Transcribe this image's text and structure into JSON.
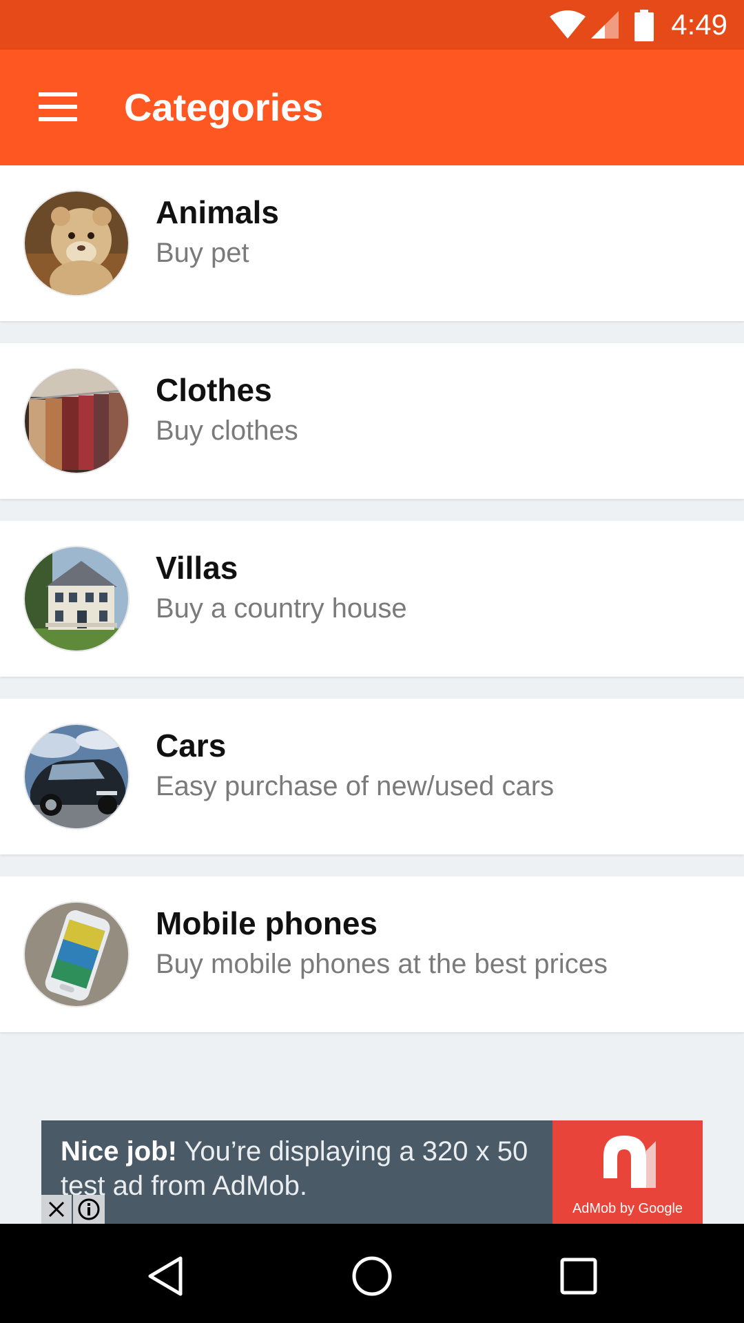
{
  "status_bar": {
    "time": "4:49",
    "icons": [
      "wifi-icon",
      "signal-icon",
      "battery-icon"
    ]
  },
  "app_bar": {
    "title": "Categories",
    "menu_icon": "menu-icon",
    "background": "#ff5722",
    "status_background": "#e64a19"
  },
  "categories": [
    {
      "name": "Animals",
      "subtitle": "Buy pet",
      "image": "lion-cub-photo"
    },
    {
      "name": "Clothes",
      "subtitle": "Buy clothes",
      "image": "clothes-rack-photo"
    },
    {
      "name": "Villas",
      "subtitle": "Buy a country house",
      "image": "house-photo"
    },
    {
      "name": "Cars",
      "subtitle": "Easy purchase of new/used cars",
      "image": "car-photo"
    },
    {
      "name": "Mobile phones",
      "subtitle": "Buy mobile phones at the best prices",
      "image": "smartphone-photo"
    }
  ],
  "ad": {
    "headline": "Nice job!",
    "body": " You’re displaying a 320 x 50 test ad from AdMob.",
    "brand": "AdMob by Google",
    "brand_color": "#e8443a"
  },
  "nav_bar": {
    "icons": [
      "back-icon",
      "home-icon",
      "recents-icon"
    ]
  }
}
